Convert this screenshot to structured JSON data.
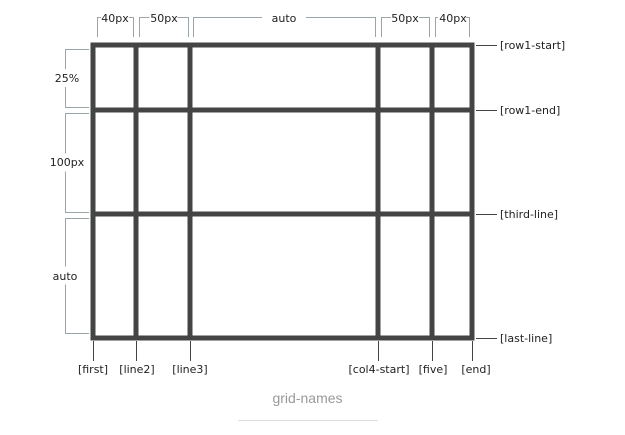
{
  "title": "grid-names",
  "column_sizes": [
    "40px",
    "50px",
    "auto",
    "50px",
    "40px"
  ],
  "row_sizes": [
    "25%",
    "100px",
    "auto"
  ],
  "column_line_names": [
    "[first]",
    "[line2]",
    "[line3]",
    "[col4-start]",
    "[five]",
    "[end]"
  ],
  "row_line_names": [
    "[row1-start]",
    "[row1-end]",
    "[third-line]",
    "[last-line]"
  ],
  "colors": {
    "grid": "#444444",
    "bracket": "#9aa5aa",
    "caption": "#999999"
  }
}
